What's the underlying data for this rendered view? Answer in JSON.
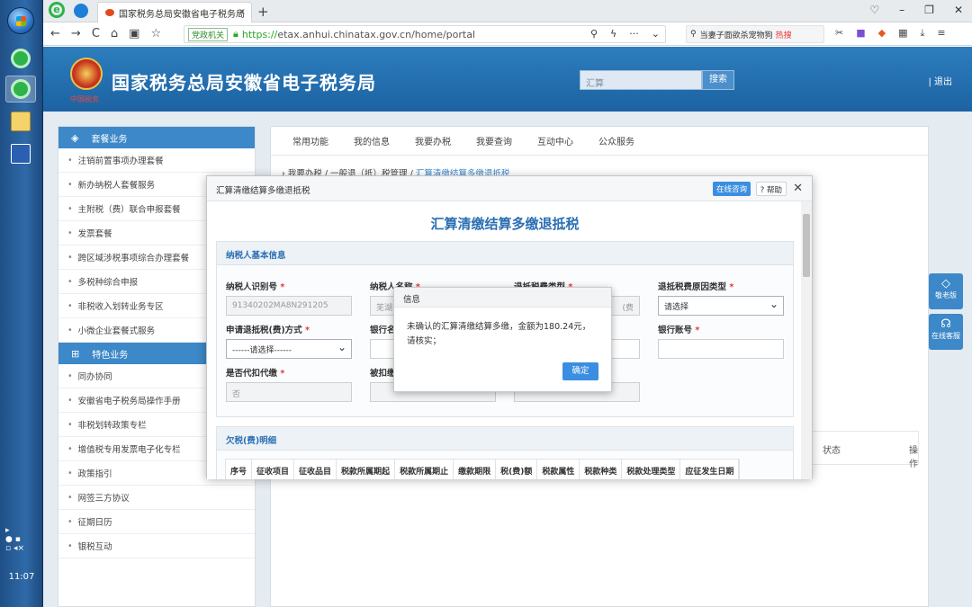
{
  "taskbar": {
    "clock": "11:07"
  },
  "browser": {
    "tab_title": "国家税务总局安徽省电子税务局",
    "address": {
      "gov_badge": "党政机关",
      "url_https": "https://",
      "url_rest": "etax.anhui.chinatax.gov.cn/home/portal"
    },
    "search": {
      "text": "当妻子面欲杀宠物狗",
      "hot": "热搜"
    }
  },
  "site": {
    "emblem_text": "中国税务",
    "title": "国家税务总局安徽省电子税务局",
    "search_value": "汇算",
    "search_button": "搜索",
    "logout": "| 退出"
  },
  "sidebar": {
    "section1": "套餐业务",
    "items1": [
      "注销前置事项办理套餐",
      "新办纳税人套餐服务",
      "主附税（费）联合申报套餐",
      "发票套餐",
      "跨区域涉税事项综合办理套餐",
      "多税种综合申报",
      "非税收入划转业务专区",
      "小微企业套餐式服务"
    ],
    "section2": "特色业务",
    "items2": [
      "同办协同",
      "安徽省电子税务局操作手册",
      "非税划转政策专栏",
      "增值税专用发票电子化专栏",
      "政策指引",
      "网签三方协议",
      "征期日历",
      "银税互动"
    ]
  },
  "main": {
    "topnav": [
      "常用功能",
      "我的信息",
      "我要办税",
      "我要查询",
      "互动中心",
      "公众服务"
    ],
    "crumb_prefix": "› 我要办税 / 一般退（抵）税管理 / ",
    "crumb_current": "汇算清缴结算多缴退抵税",
    "table_headers": {
      "status": "状态",
      "action": "操作"
    },
    "float1": "敬老版",
    "float2": "在线客服"
  },
  "dialog": {
    "title": "汇算清缴结算多缴退抵税",
    "online": "在线咨询",
    "help": "? 帮助",
    "form_title": "汇算清缴结算多缴退抵税",
    "section_basic": "纳税人基本信息",
    "labels": {
      "taxid": "纳税人识别号",
      "name": "纳税人名称",
      "refund_type": "退抵税费类型",
      "reason": "退抵税费原因类型",
      "method": "申请退抵税(费)方式",
      "bank_name": "银行名称",
      "bank_acct": "银行账号",
      "withhold": "是否代扣代缴",
      "withheld": "被扣缴"
    },
    "values": {
      "taxid": "91340202MA8N291205",
      "name": "芜湖",
      "refund_type": "(费",
      "reason_select": "请选择",
      "method_select": "------请选择------",
      "withhold": "否"
    },
    "section_owe": "欠税(费)明细",
    "owe_headers": [
      "序号",
      "征收项目",
      "征收品目",
      "税款所属期起",
      "税款所属期止",
      "缴款期限",
      "税(费)额",
      "税款属性",
      "税款种类",
      "税款处理类型",
      "应征发生日期"
    ]
  },
  "message": {
    "title": "信息",
    "body": "未确认的汇算清缴结算多缴，金额为180.24元，请核实；",
    "confirm": "确定"
  }
}
